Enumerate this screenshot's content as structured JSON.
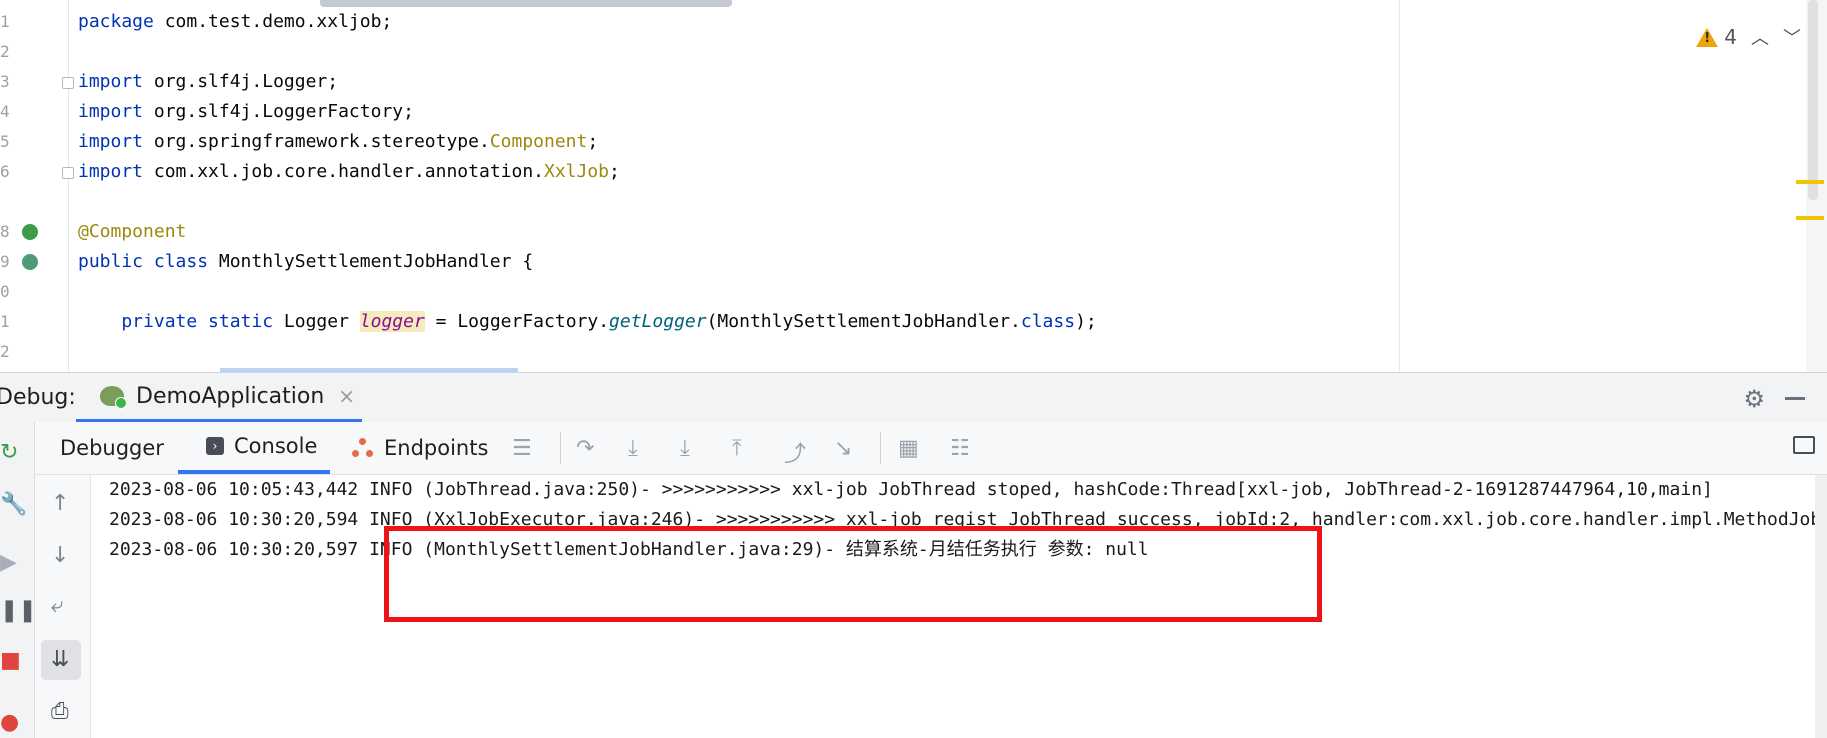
{
  "editor": {
    "line_numbers": [
      "1",
      "2",
      "3",
      "4",
      "5",
      "6",
      "",
      "8",
      "9",
      "0",
      "1",
      "2"
    ],
    "lines": [
      [
        {
          "t": "package",
          "c": "kw"
        },
        {
          "t": " com.test.demo.xxljob;",
          "c": ""
        }
      ],
      [],
      [
        {
          "t": "import",
          "c": "kw"
        },
        {
          "t": " org.slf4j.Logger;",
          "c": ""
        }
      ],
      [
        {
          "t": "import",
          "c": "kw"
        },
        {
          "t": " org.slf4j.LoggerFactory;",
          "c": ""
        }
      ],
      [
        {
          "t": "import",
          "c": "kw"
        },
        {
          "t": " org.springframework.stereotype.",
          "c": ""
        },
        {
          "t": "Component",
          "c": "cls"
        },
        {
          "t": ";",
          "c": ""
        }
      ],
      [
        {
          "t": "import",
          "c": "kw"
        },
        {
          "t": " com.xxl.job.core.handler.annotation.",
          "c": ""
        },
        {
          "t": "XxlJob",
          "c": "cls"
        },
        {
          "t": ";",
          "c": ""
        }
      ],
      [],
      [
        {
          "t": "@Component",
          "c": "ann"
        }
      ],
      [
        {
          "t": "public class",
          "c": "kw"
        },
        {
          "t": " MonthlySettlementJobHandler {",
          "c": ""
        }
      ],
      [],
      [
        {
          "t": "    private static",
          "c": "kw"
        },
        {
          "t": " Logger ",
          "c": ""
        },
        {
          "t": "logger",
          "c": "fld"
        },
        {
          "t": " = LoggerFactory.",
          "c": ""
        },
        {
          "t": "getLogger",
          "c": "mth"
        },
        {
          "t": "(MonthlySettlementJobHandler.",
          "c": ""
        },
        {
          "t": "class",
          "c": "kw"
        },
        {
          "t": ");",
          "c": ""
        }
      ],
      []
    ],
    "warning_count": "4",
    "colors": {
      "keyword": "#0033b3",
      "annotation": "#9e880d",
      "field": "#871094",
      "method": "#00627a",
      "warning": "#f0a30a"
    }
  },
  "debug": {
    "label": "Debug:",
    "run_tab": "DemoApplication",
    "run_tab_close": "×",
    "tabs": {
      "debugger": "Debugger",
      "console": "Console",
      "endpoints": "Endpoints"
    },
    "icons": [
      "rerun-icon",
      "settings-wrench-icon",
      "resume-icon",
      "pause-icon",
      "stop-icon",
      "up-arrow-icon",
      "down-arrow-icon",
      "soft-wrap-icon",
      "scroll-to-end-icon",
      "print-icon",
      "gear-icon",
      "minimize-icon"
    ]
  },
  "console": {
    "lines": [
      "2023-08-06 10:05:43,442 INFO (JobThread.java:250)- >>>>>>>>>>> xxl-job JobThread stoped, hashCode:Thread[xxl-job, JobThread-2-1691287447964,10,main]",
      "2023-08-06 10:30:20,594 INFO (XxlJobExecutor.java:246)- >>>>>>>>>>> xxl-job regist JobThread success, jobId:2, handler:com.xxl.job.core.handler.impl.MethodJobHandler",
      "2023-08-06 10:30:20,597 INFO (MonthlySettlementJobHandler.java:29)- 结算系统-月结任务执行 参数: null"
    ],
    "highlight_color": "#ec1414"
  }
}
